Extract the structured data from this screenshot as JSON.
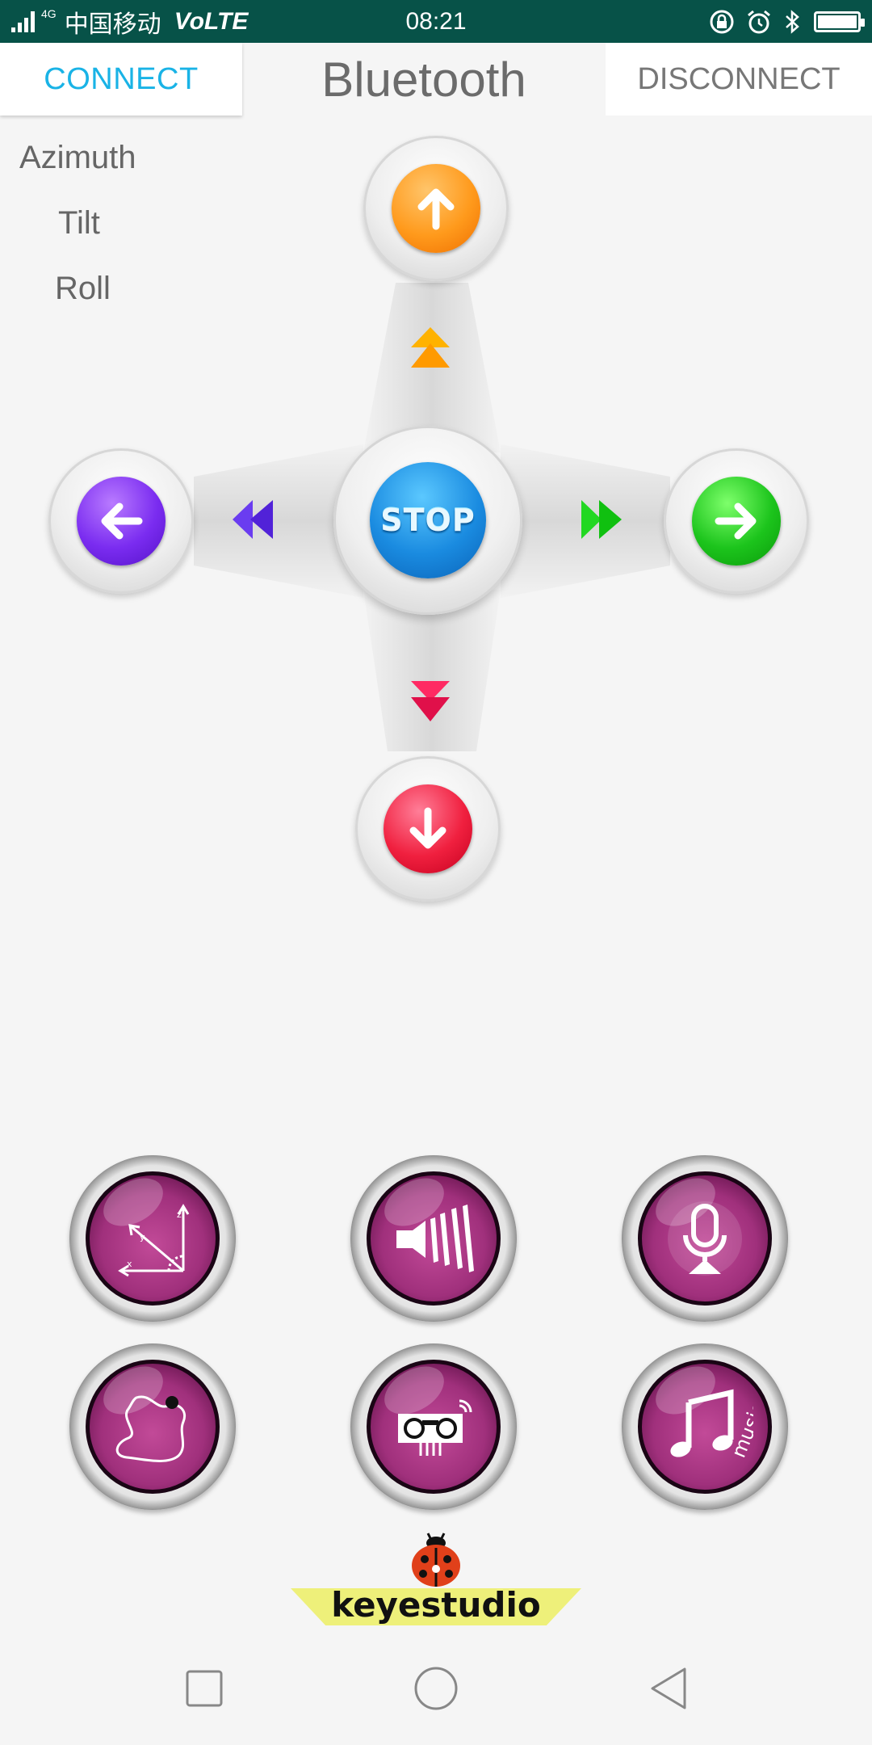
{
  "status_bar": {
    "network_type": "4G",
    "carrier": "中国移动",
    "volte": "VoLTE",
    "time": "08:21",
    "icons": [
      "lock-rotation-icon",
      "alarm-icon",
      "bluetooth-icon",
      "battery-icon"
    ]
  },
  "header": {
    "connect_label": "CONNECT",
    "title": "Bluetooth",
    "disconnect_label": "DISCONNECT"
  },
  "sensors": {
    "azimuth": "Azimuth",
    "tilt": "Tilt",
    "roll": "Roll"
  },
  "dpad": {
    "stop_label": "STOP",
    "colors": {
      "up": "#ff9a1c",
      "left": "#7a2cf0",
      "right": "#1cc41c",
      "down": "#f0203f",
      "stop": "#1a8be0"
    }
  },
  "features": [
    {
      "name": "gravity-axes-icon"
    },
    {
      "name": "ultrasonic-speaker-icon"
    },
    {
      "name": "microphone-icon"
    },
    {
      "name": "line-tracking-icon"
    },
    {
      "name": "obstacle-robot-icon"
    },
    {
      "name": "music-note-icon",
      "label": "music"
    }
  ],
  "logo": {
    "text": "keyestudio"
  },
  "navigation": {
    "icons": [
      "recent-apps-icon",
      "home-icon",
      "back-icon"
    ]
  }
}
